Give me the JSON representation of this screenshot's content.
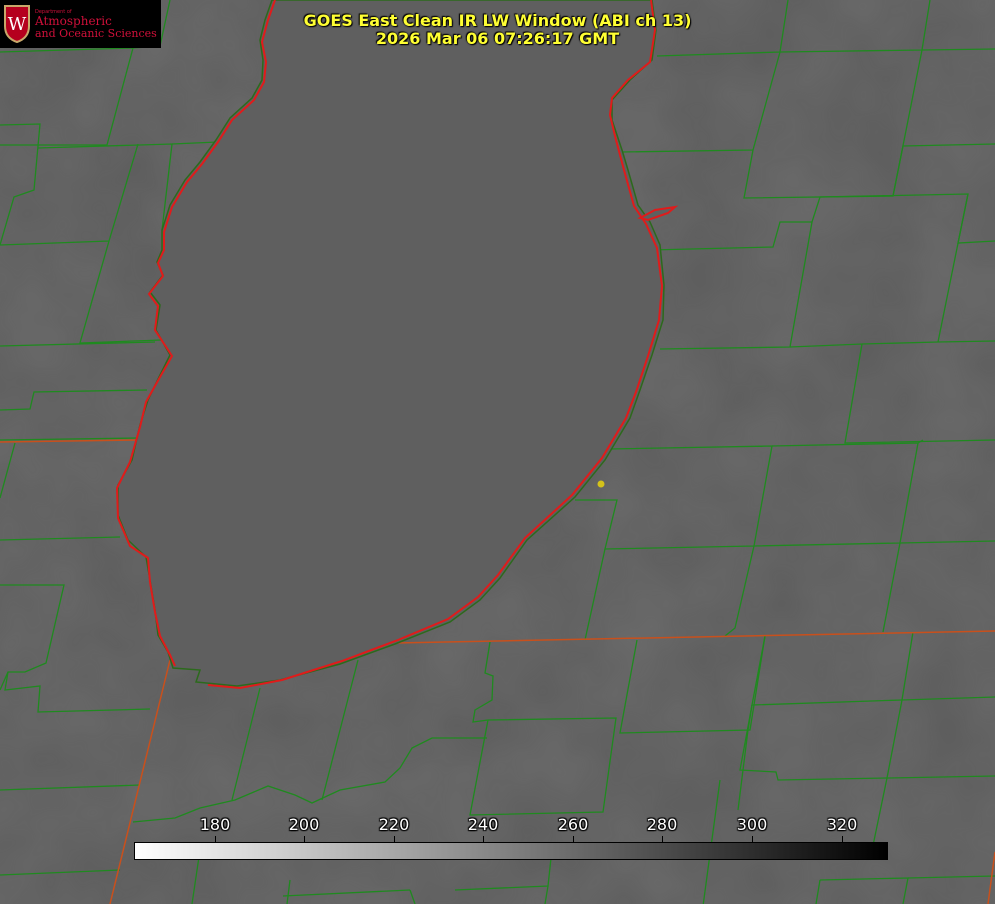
{
  "header": {
    "title_line1": "GOES East Clean IR LW Window (ABI ch 13)",
    "title_line2": "2026 Mar 06 07:26:17 GMT"
  },
  "logo": {
    "department": "Department of",
    "line1": "Atmospheric",
    "line2": "and Oceanic Sciences",
    "seal_letter": "W"
  },
  "colorbar": {
    "ticks": [
      "180",
      "200",
      "220",
      "240",
      "260",
      "280",
      "300",
      "320"
    ],
    "gradient": [
      "#ffffff",
      "#000000"
    ]
  },
  "colors": {
    "background": "#5e5e5e",
    "county_lines": "#1f8a1f",
    "coastline": "#e01b1b",
    "title": "#ffff33",
    "marker": "#d4c21a"
  }
}
